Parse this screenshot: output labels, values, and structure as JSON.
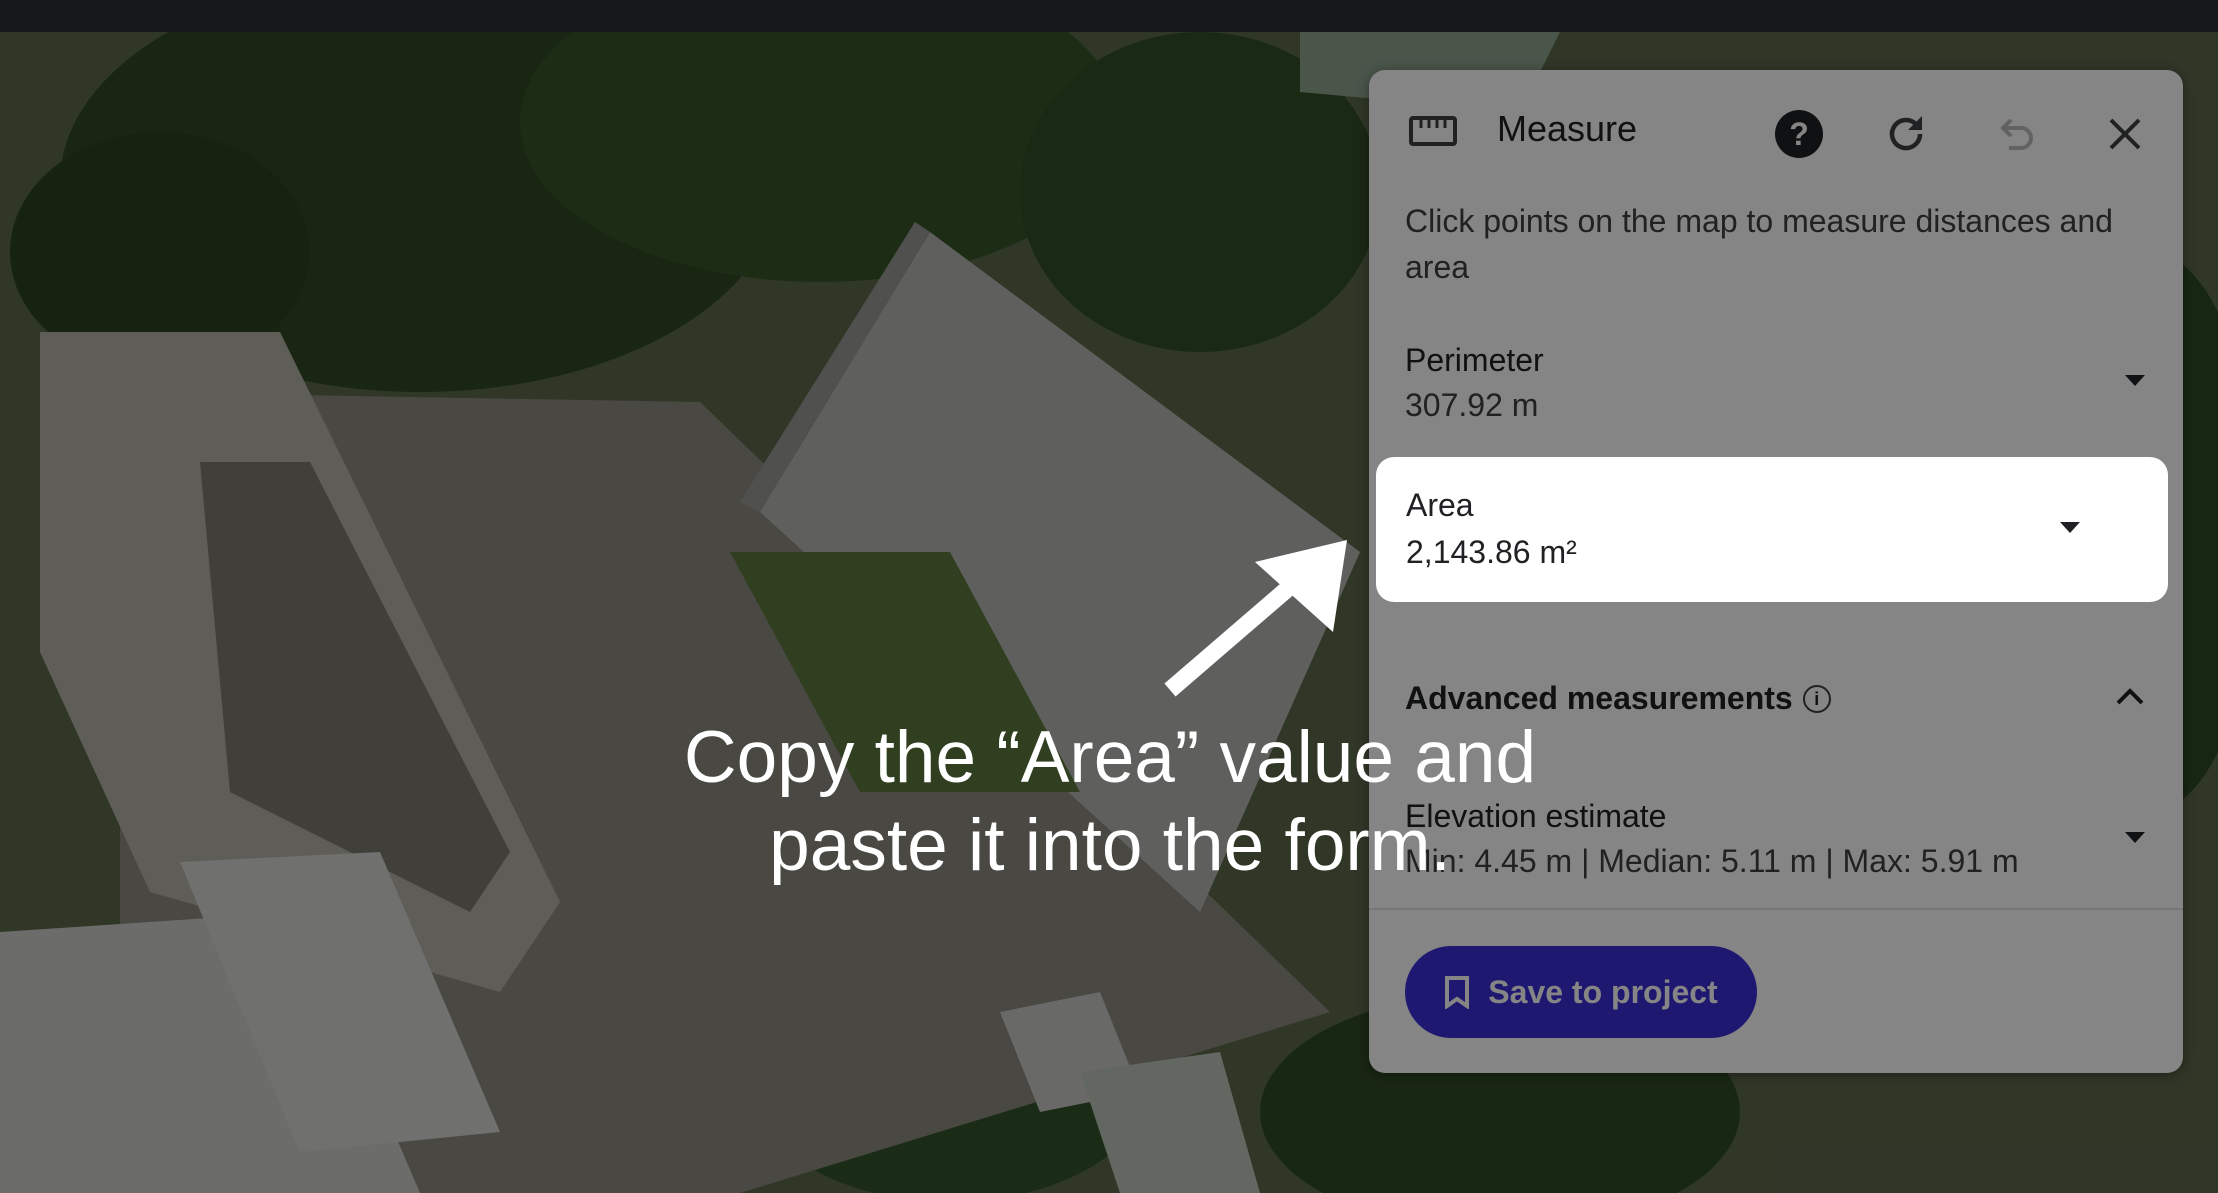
{
  "panel": {
    "title": "Measure",
    "icons": {
      "ruler": "ruler-icon",
      "help": "help-icon",
      "reset": "refresh-icon",
      "undo": "undo-icon",
      "close": "close-icon"
    },
    "description": "Click points on the map to measure distances and area",
    "perimeter": {
      "label": "Perimeter",
      "value": "307.92 m"
    },
    "area": {
      "label": "Area",
      "value": "2,143.86 m²"
    },
    "advanced": {
      "label": "Advanced measurements"
    },
    "elevation": {
      "label": "Elevation estimate",
      "value": "Min: 4.45 m | Median: 5.11 m | Max: 5.91 m"
    },
    "save_label": "Save to project"
  },
  "instruction": {
    "line1": "Copy the “Area” value and",
    "line2": "paste it into the form."
  },
  "colors": {
    "accent": "#3d2ed7",
    "overlay": "rgba(0,0,0,0.48)"
  }
}
